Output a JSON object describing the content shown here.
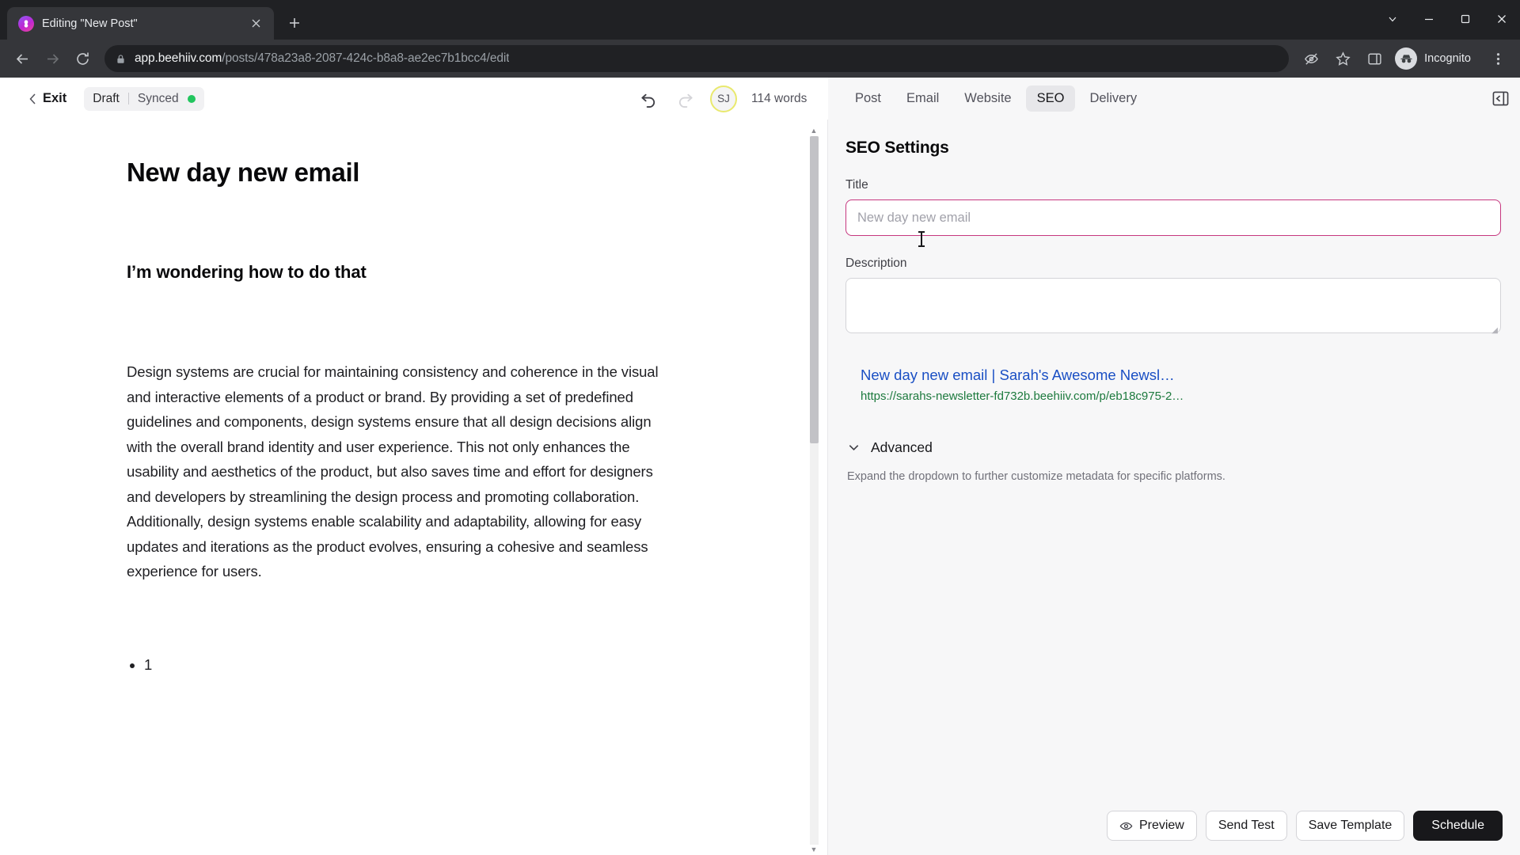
{
  "browser": {
    "tab": {
      "title": "Editing \"New Post\"",
      "favicon": "beehiiv-logo-icon",
      "close": "×"
    },
    "newtab_label": "+",
    "window_controls": {
      "minimize": "minimize-icon",
      "maximize": "maximize-icon",
      "close": "close-icon",
      "more": "chevron-down-icon"
    },
    "nav": {
      "back": "back-arrow-icon",
      "forward": "forward-arrow-icon",
      "reload": "reload-icon"
    },
    "url": {
      "host": "app.beehiiv.com",
      "path": "/posts/478a23a8-2087-424c-b8a8-ae2ec7b1bcc4/edit",
      "lock": "lock-icon"
    },
    "toolbar_right": {
      "tracking_protection": "eye-off-icon",
      "bookmark": "star-icon",
      "side_panel": "side-panel-icon",
      "profile_label": "Incognito",
      "menu": "kebab-menu-icon"
    }
  },
  "app_toolbar": {
    "exit_label": "Exit",
    "status_draft": "Draft",
    "status_synced": "Synced",
    "undo": "undo-icon",
    "redo": "redo-icon",
    "avatar_initials": "SJ",
    "word_count": "114 words"
  },
  "editor": {
    "heading1": "New day new email",
    "heading2": "I’m wondering how to do that",
    "paragraph": "Design systems are crucial for maintaining consistency and coherence in the visual and interactive elements of a product or brand. By providing a set of predefined guidelines and components, design systems ensure that all design decisions align with the overall brand identity and user experience. This not only enhances the usability and aesthetics of the product, but also saves time and effort for designers and developers by streamlining the design process and promoting collaboration. Additionally, design systems enable scalability and adaptability, allowing for easy updates and iterations as the product evolves, ensuring a cohesive and seamless experience for users.",
    "list_item_1": "1"
  },
  "panel": {
    "tabs": [
      {
        "label": "Post",
        "active": false
      },
      {
        "label": "Email",
        "active": false
      },
      {
        "label": "Website",
        "active": false
      },
      {
        "label": "SEO",
        "active": true
      },
      {
        "label": "Delivery",
        "active": false
      }
    ],
    "collapse_icon": "collapse-panel-icon",
    "heading": "SEO Settings",
    "title_field": {
      "label": "Title",
      "value": "",
      "placeholder": "New day new email"
    },
    "description_field": {
      "label": "Description",
      "value": "",
      "placeholder": ""
    },
    "preview": {
      "title": "New day new email | Sarah's Awesome Newsl…",
      "url": "https://sarahs-newsletter-fd732b.beehiiv.com/p/eb18c975-2…"
    },
    "advanced": {
      "label": "Advanced",
      "chevron": "chevron-down-icon",
      "hint": "Expand the dropdown to further customize metadata for specific platforms."
    },
    "footer": {
      "preview": "Preview",
      "preview_icon": "eye-icon",
      "send_test": "Send Test",
      "save_template": "Save Template",
      "schedule": "Schedule"
    }
  },
  "colors": {
    "accent_focus": "#c6377f",
    "status_dot": "#22c55e",
    "primary_button": "#18181b",
    "serp_title": "#1a4fc4",
    "serp_url": "#1d7a3e",
    "avatar_ring": "#e9e96e"
  }
}
